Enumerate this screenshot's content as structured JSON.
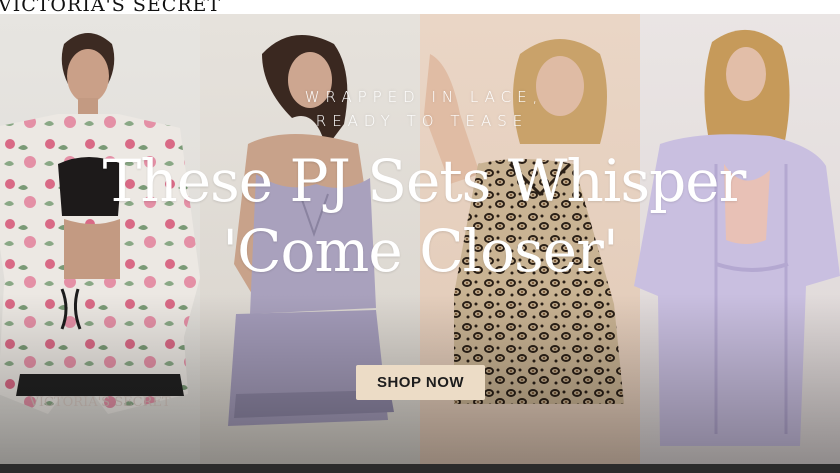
{
  "header": {
    "logo_text": "VICTORIA'S SECRET"
  },
  "hero": {
    "eyebrow_line_1": "WRAPPED IN LACE,",
    "eyebrow_line_2": "READY TO TEASE",
    "headline_line_1": "These PJ Sets Whisper",
    "headline_line_2": "'Come Closer'",
    "cta_label": "SHOP NOW",
    "shorts_waistband_text": "VICTORIA'S SECRET"
  },
  "colors": {
    "cta_background": "#ecdcc6",
    "headline_text": "#ffffff",
    "panel_backgrounds": [
      "#e3e0dc",
      "#dfdad4",
      "#e6cfbe",
      "#e5dfde"
    ]
  },
  "images": [
    {
      "name": "model-floral-satin-pj-set"
    },
    {
      "name": "model-lilac-lace-cami-set"
    },
    {
      "name": "model-leopard-print-cami-set"
    },
    {
      "name": "model-lilac-robe-set"
    }
  ]
}
